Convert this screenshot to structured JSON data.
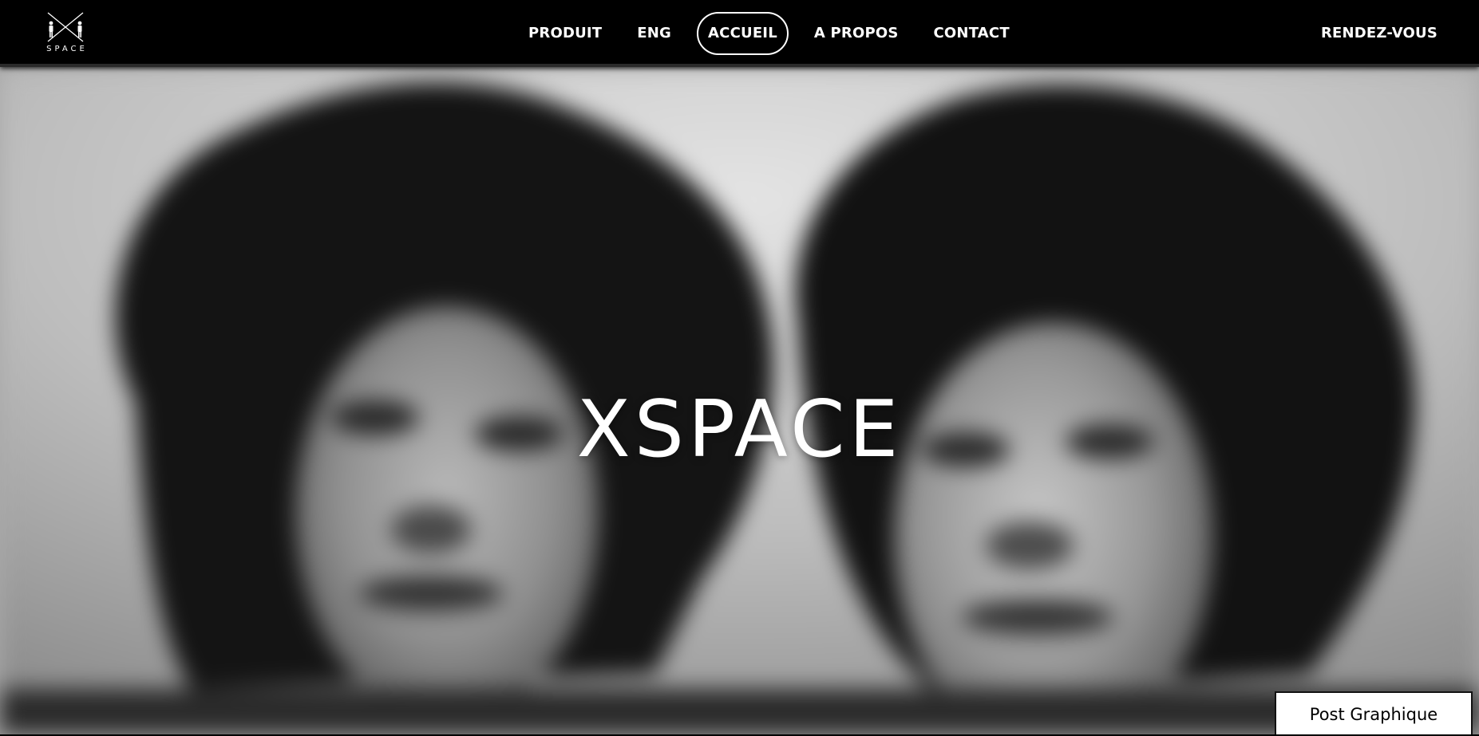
{
  "logo": {
    "text": "SPACE",
    "icon": "x-figures-logo-icon"
  },
  "nav": {
    "items": [
      {
        "label": "PRODUIT",
        "active": false
      },
      {
        "label": "ENG",
        "active": false
      },
      {
        "label": "ACCUEIL",
        "active": true
      },
      {
        "label": "A PROPOS",
        "active": false
      },
      {
        "label": "CONTACT",
        "active": false
      }
    ],
    "appointment_label": "RENDEZ-VOUS"
  },
  "hero": {
    "title": "XSPACE",
    "image": "blurred-portrait-photo"
  },
  "badge": {
    "label": "Post Graphique"
  },
  "colors": {
    "header_bg": "#000000",
    "text": "#ffffff",
    "badge_bg": "#ffffff",
    "badge_text": "#000000"
  }
}
